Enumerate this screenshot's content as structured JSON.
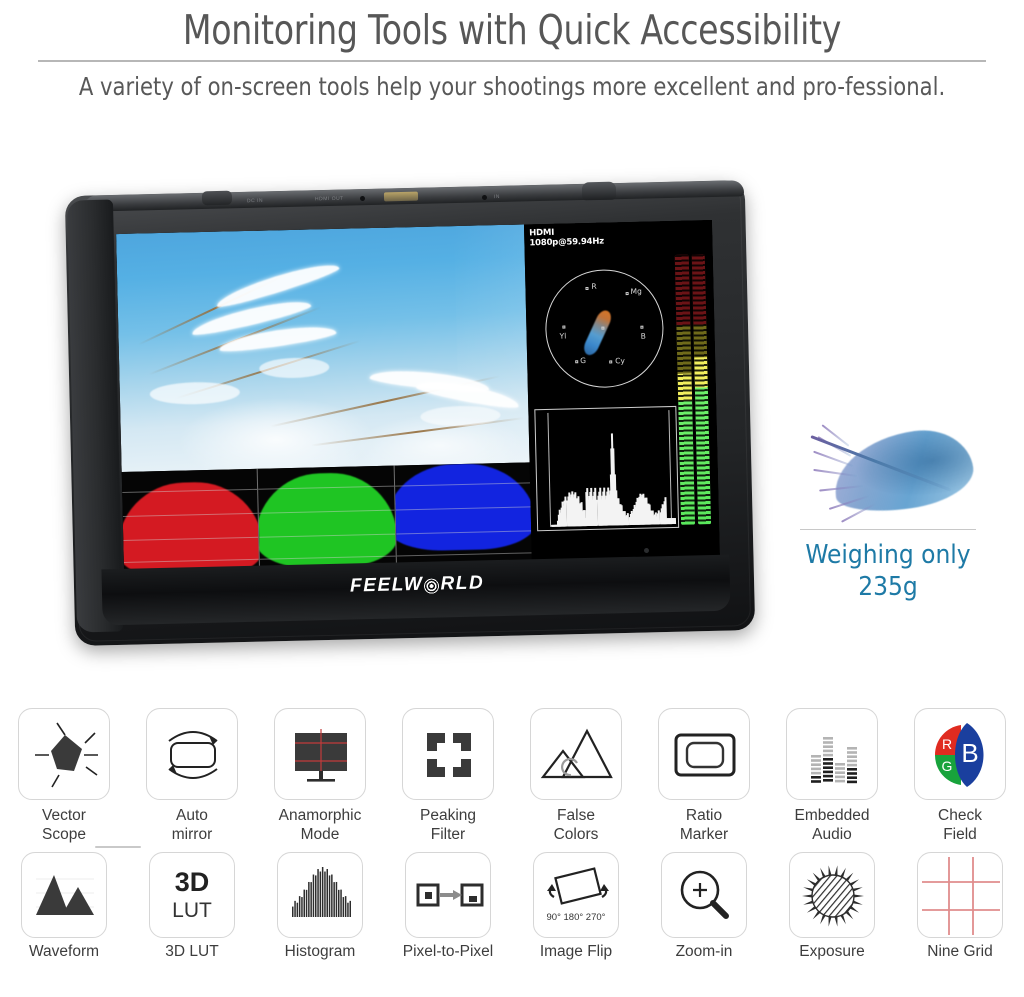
{
  "header": {
    "title": "Monitoring Tools with Quick Accessibility",
    "subtitle": "A variety of on-screen tools help your shootings more excellent and pro-fessional."
  },
  "monitor": {
    "brand_logo": "FEELW",
    "brand_logo_tail": "RLD",
    "osd": {
      "signal_label": "HDMI",
      "signal_format": "1080p@59.94Hz"
    },
    "vectorscope": {
      "labels": [
        "R",
        "Mg",
        "B",
        "Cy",
        "G",
        "Yl"
      ]
    },
    "scopes": [
      "rgb-parade-waveform",
      "vectorscope",
      "histogram",
      "audio-level-meters"
    ]
  },
  "callout": {
    "icon": "feather-icon",
    "line1": "Weighing only",
    "line2": "235g",
    "color": "#1e7aa6"
  },
  "features": {
    "row1": [
      {
        "name": "vector-scope",
        "label": "Vector\nScope"
      },
      {
        "name": "auto-mirror",
        "label": "Auto\nmirror"
      },
      {
        "name": "anamorphic-mode",
        "label": "Anamorphic\nMode"
      },
      {
        "name": "peaking-filter",
        "label": "Peaking\nFilter"
      },
      {
        "name": "false-colors",
        "label": "False\nColors"
      },
      {
        "name": "ratio-marker",
        "label": "Ratio\nMarker"
      },
      {
        "name": "embedded-audio",
        "label": "Embedded\nAudio"
      },
      {
        "name": "check-field",
        "label": "Check\nField"
      }
    ],
    "row2": [
      {
        "name": "waveform",
        "label": "Waveform"
      },
      {
        "name": "3d-lut",
        "label": "3D LUT",
        "tile_text_top": "3D",
        "tile_text_bottom": "LUT"
      },
      {
        "name": "histogram",
        "label": "Histogram"
      },
      {
        "name": "pixel-to-pixel",
        "label": "Pixel-to-Pixel"
      },
      {
        "name": "image-flip",
        "label": "Image Flip",
        "tile_text": "90° 180° 270°"
      },
      {
        "name": "zoom-in",
        "label": "Zoom-in"
      },
      {
        "name": "exposure",
        "label": "Exposure"
      },
      {
        "name": "nine-grid",
        "label": "Nine Grid"
      }
    ]
  },
  "check_field_icon": {
    "r": "R",
    "g": "G",
    "b": "B",
    "red": "#e02b20",
    "green": "#18a33c",
    "blue": "#1a3f9e"
  }
}
